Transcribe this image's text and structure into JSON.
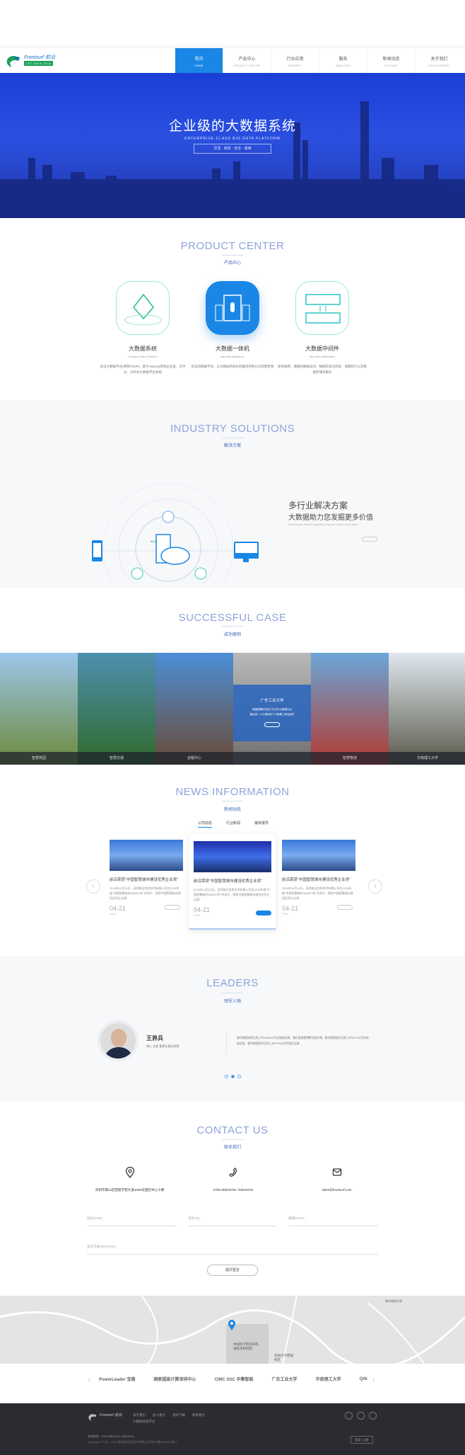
{
  "header": {
    "logo_text": "Frontsurf 前沿",
    "logo_slogan": "LET DATA TALK",
    "nav": [
      {
        "cn": "首页",
        "en": "HOME"
      },
      {
        "cn": "产品中心",
        "en": "PRODUCT CENTER"
      },
      {
        "cn": "行业应用",
        "en": "SECURITY"
      },
      {
        "cn": "服务",
        "en": "ANALYSES"
      },
      {
        "cn": "新闻动态",
        "en": "EXTRACT"
      },
      {
        "cn": "关于我们",
        "en": "DEVELOPMENT"
      }
    ]
  },
  "hero": {
    "title": "企业级的大数据系统",
    "subtitle": "ENTERPRISE CLASS BIG DATA PLATFORM",
    "tags": "灵活 · 高效 · 安全 · 易用"
  },
  "product": {
    "title": "PRODUCT CENTER",
    "subtitle": "产品中心",
    "items": [
      {
        "name": "大数据系统",
        "en": "Frontsurf Data Platform",
        "desc": "前沿大数据平台(简称FSDP)，基于Hadoop架构企业级、全中文、分布式大数据平台系统",
        "icon": "diamond-crystal-icon"
      },
      {
        "name": "大数据一体机",
        "en": "Big Data Appliance",
        "desc": "优化的数据平台，让大数据系统达到最佳的性价比和稳定性",
        "icon": "server-appliance-icon"
      },
      {
        "name": "大数据中间件",
        "en": "Big data middleware",
        "desc": "提供通用、便捷的数据访问、数据检索与检索、海量统计以及数据存储等服务",
        "icon": "middleware-system-icon"
      }
    ]
  },
  "industry": {
    "title": "INDUSTRY SOLUTIONS",
    "subtitle": "解决方案",
    "heading1": "多行业解决方案",
    "heading2": "大数据助力您发掘更多价值",
    "desc": "Multi-industry solutions big data to help you explore more value",
    "diagram_label": "BDA"
  },
  "cases": {
    "title": "SUCCESSFUL CASE",
    "subtitle": "成功案例",
    "items": [
      {
        "label": "智慧校园",
        "colors": [
          "#9cc6ec",
          "#6d8a3a"
        ]
      },
      {
        "label": "智慧交通",
        "colors": [
          "#4f8fb0",
          "#2f6a2a"
        ]
      },
      {
        "label": "远程中心",
        "colors": [
          "#4c8fd8",
          "#6a4a34"
        ]
      },
      {
        "label": "",
        "colors": [
          "#b9b9b9",
          "#6f6f6f"
        ]
      },
      {
        "label": "智慧物流",
        "colors": [
          "#6aa6d8",
          "#b43a30"
        ]
      },
      {
        "label": "华南理工大学",
        "colors": [
          "#dfe8f0",
          "#5a5a4a"
        ]
      }
    ],
    "overlay": {
      "title": "广东工业大学",
      "line1": "搭建部署并完成了在过去大数据平台",
      "line2": "通过统一入口调用多个大数据工具及组件"
    }
  },
  "news": {
    "title": "NEWS INFORMATION",
    "subtitle": "新闻动态",
    "tabs": [
      "公司动态",
      "行业新闻",
      "媒体报导"
    ],
    "active_tab": 0,
    "cards": [
      {
        "title": "前沿荣获“中国智慧城市建设优秀企业奖”",
        "desc": "2015年11月19日，深圳前沿信息技术有限公司在2015年度“中国智慧城市SMART杯”评选中，荣获中国智慧城市建设优秀企业奖!",
        "date": "04-21",
        "year": "2016"
      },
      {
        "title": "前沿荣获“中国智慧城市建设优秀企业奖”",
        "desc": "2015年11月19日，深圳前沿信息技术有限公司在2015年度“中国智慧城市SMART杯”评选中，荣获中国智慧城市建设优秀企业奖!",
        "date": "04-21",
        "year": "2016"
      },
      {
        "title": "前沿荣获“中国智慧城市建设优秀企业奖”",
        "desc": "2015年11月19日，深圳前沿信息技术有限公司在2015年度“中国智慧城市SMART杯”评选中，荣获中国智慧城市建设优秀企业奖!",
        "date": "04-21",
        "year": "2016"
      }
    ]
  },
  "leaders": {
    "title": "LEADERS",
    "subtitle": "领军人物",
    "name": "王界兵",
    "role": "博士  总裁  董事长兼总经理",
    "bio": "曾任美国纳斯达克上市SMAK公司全球副总裁，兼任英国德博蒙业副总裁，曾任美国纽约证券上市HITN公司全球副总裁，曾任美国纽约证券上市HITN公司中国区总裁...",
    "active_dot": 1,
    "dot_count": 3
  },
  "contact": {
    "title": "CONTACT US",
    "subtitle": "联系我们",
    "address": "深圳市南山区西丽学苑大道1068号园区中心十楼",
    "phone": "0755-86518755 / 86518753",
    "email": "sales@frontsurf.com",
    "fields": {
      "name": "姓名NAME：",
      "tel": "电话TEL：",
      "mail": "邮箱EMAIL：",
      "message": "留言内容MESSAGE："
    },
    "submit": "提交留言"
  },
  "map": {
    "labels": [
      "中国科学院深圳先进技术研究院",
      "深圳大学西丽校区",
      "南方科技大学"
    ]
  },
  "partners": [
    "PowerLeader 宝德",
    "国家超级计算深圳中心",
    "CIMC SSC 中集智能",
    "广东工业大学",
    "华南理工大学",
    "Qlik"
  ],
  "footer": {
    "links": [
      "关于我们",
      "加入我们",
      "资料下载",
      "联系我们"
    ],
    "sub_link": "大数据试验平台",
    "hotline": "咨询热线：0755-86518755 / 86518753",
    "copyright": "Copyright © 2001 - 2016  深圳前沿信息技术有限公司  粤ICP备15000075号-1",
    "login": "登录 / 注册"
  },
  "colors": {
    "accent": "#1a87e6",
    "title": "#8ea3da",
    "footer": "#2b2c30"
  }
}
